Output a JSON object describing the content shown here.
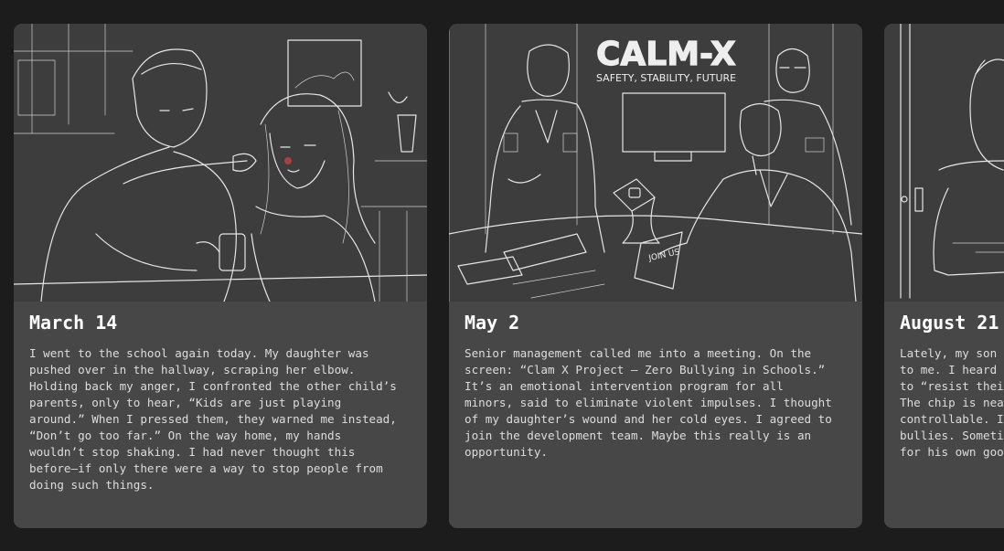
{
  "cards": [
    {
      "date": "March 14",
      "lines": [
        "I went to the school again today. My daughter was",
        "pushed over in the hallway, scraping her elbow.",
        "Holding back my anger, I confronted the other child’s",
        "parents, only to hear, “Kids are just playing",
        "around.” When I pressed them, they warned me instead,",
        "“Don’t go too far.” On the way home, my hands",
        "wouldn’t stop shaking. I had never thought this",
        "before—if only there were a way to stop people from",
        "doing such things."
      ]
    },
    {
      "date": "May 2",
      "screen_title": "CALM-X",
      "screen_subtitle": "SAFETY, STABILITY, FUTURE",
      "document_label": "JOIN US",
      "lines": [
        "Senior management called me into a meeting. On the",
        "screen: “Clam X Project — Zero Bullying in Schools.”",
        "It’s an emotional intervention program for all",
        "minors, said to eliminate violent impulses. I thought",
        "of my daughter’s wound and her cold eyes. I agreed to",
        "join the development team. Maybe this really is an",
        "opportunity."
      ]
    },
    {
      "date": "August 21",
      "lines": [
        "Lately, my son",
        "to me. I heard",
        "to “resist thei",
        "The chip is nea",
        "controllable. I",
        "bullies. Someti",
        "for his own goo"
      ]
    }
  ]
}
